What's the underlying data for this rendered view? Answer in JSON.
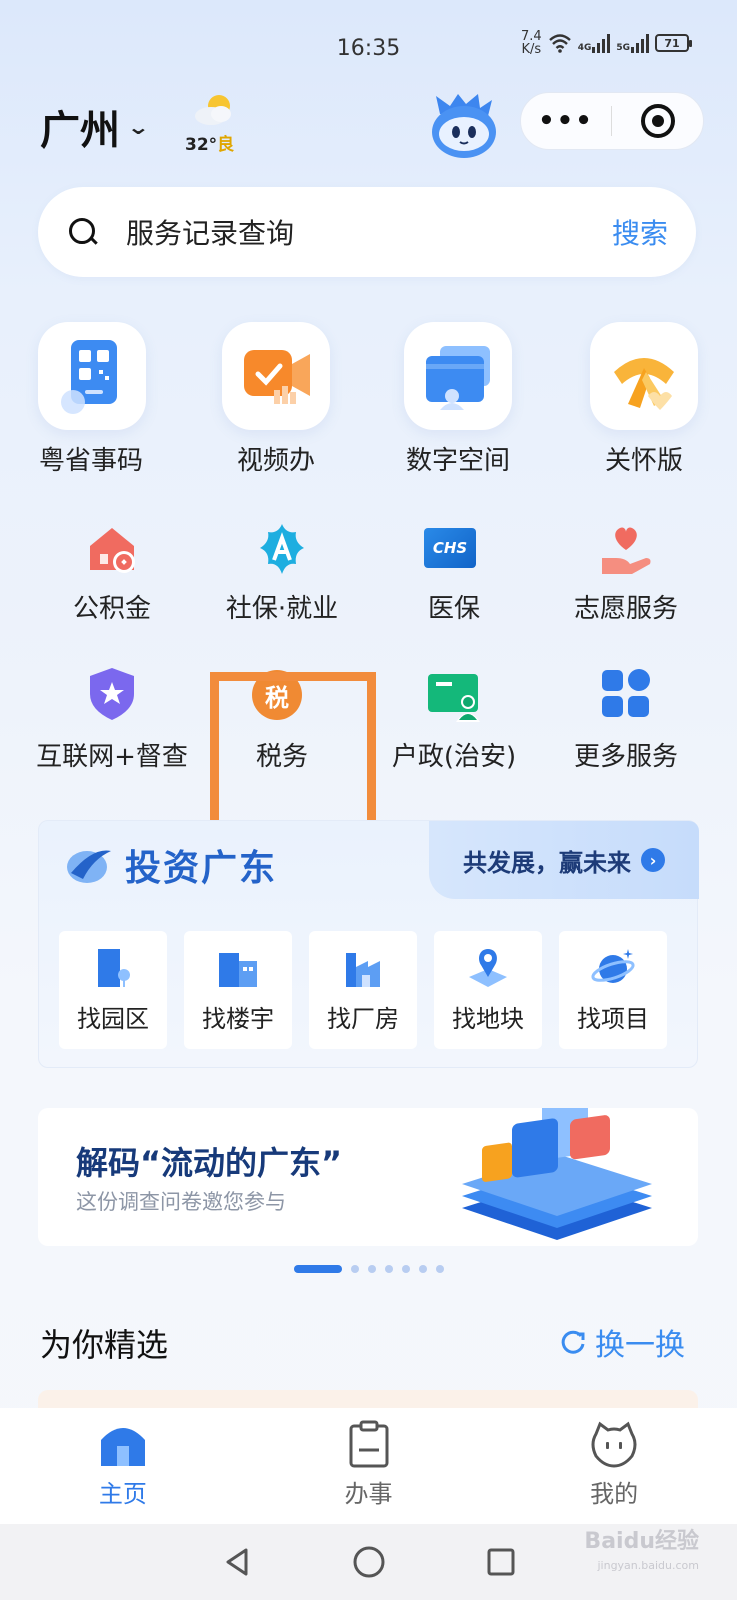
{
  "status_bar": {
    "time": "16:35",
    "speed_value": "7.4",
    "speed_unit": "K/s",
    "sig1": "4G",
    "sig2": "5G",
    "battery": "71"
  },
  "header": {
    "city": "广州",
    "weather_temp": "32°",
    "weather_quality": "良",
    "mascot": "robot-mascot-icon",
    "more_icon": "more-dots-icon",
    "target_icon": "target-icon"
  },
  "search": {
    "placeholder": "服务记录查询",
    "button": "搜索"
  },
  "apps": [
    {
      "label": "粤省事码",
      "icon": "qr-code-icon"
    },
    {
      "label": "视频办",
      "icon": "video-icon"
    },
    {
      "label": "数字空间",
      "icon": "folder-icon"
    },
    {
      "label": "关怀版",
      "icon": "scarf-icon"
    }
  ],
  "services": [
    {
      "label": "公积金",
      "icon": "house-coin-icon"
    },
    {
      "label": "社保·就业",
      "icon": "social-security-icon"
    },
    {
      "label": "医保",
      "icon": "chs-icon",
      "icon_text": "CHS"
    },
    {
      "label": "志愿服务",
      "icon": "heart-hand-icon"
    },
    {
      "label": "互联网+督查",
      "icon": "shield-star-icon"
    },
    {
      "label": "税务",
      "icon": "tax-icon",
      "icon_text": "税"
    },
    {
      "label": "户政(治安)",
      "icon": "id-card-icon"
    },
    {
      "label": "更多服务",
      "icon": "grid-icon"
    }
  ],
  "investment": {
    "title": "投资广东",
    "slogan": "共发展，赢未来",
    "items": [
      {
        "label": "找园区",
        "icon": "park-icon"
      },
      {
        "label": "找楼宇",
        "icon": "building-icon"
      },
      {
        "label": "找厂房",
        "icon": "factory-icon"
      },
      {
        "label": "找地块",
        "icon": "land-pin-icon"
      },
      {
        "label": "找项目",
        "icon": "planet-icon"
      }
    ]
  },
  "banner": {
    "title": "解码“流动的广东”",
    "subtitle": "这份调查问卷邀您参与"
  },
  "carousel": {
    "active_index": 1,
    "total": 7
  },
  "recommend": {
    "title": "为你精选",
    "refresh": "换一换"
  },
  "tabbar": [
    {
      "label": "主页",
      "icon": "home-icon",
      "active": true
    },
    {
      "label": "办事",
      "icon": "clipboard-icon",
      "active": false
    },
    {
      "label": "我的",
      "icon": "profile-face-icon",
      "active": false
    }
  ],
  "watermark": {
    "line1": "Baidu经验",
    "line2": "jingyan.baidu.com"
  }
}
